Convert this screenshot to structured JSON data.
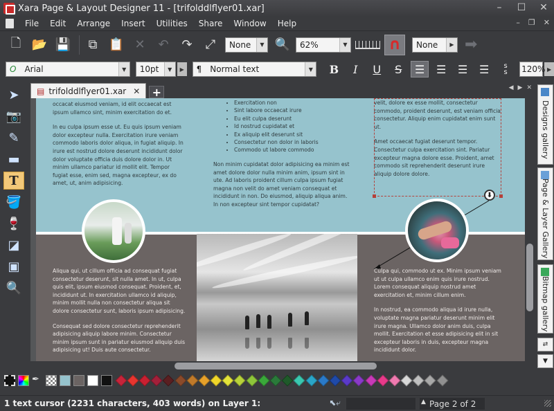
{
  "window": {
    "title": "Xara Page & Layout Designer 11 - [trifolddlflyer01.xar]",
    "minimize": "–",
    "maximize": "☐",
    "close": "✕"
  },
  "menu": {
    "items": [
      "File",
      "Edit",
      "Arrange",
      "Insert",
      "Utilities",
      "Share",
      "Window",
      "Help"
    ]
  },
  "toolbar": {
    "snap_combo": "None",
    "zoom_combo": "62%",
    "second_snap_combo": "None"
  },
  "format": {
    "font": "Arial",
    "size": "10pt",
    "style": "Normal text",
    "bold": "B",
    "italic": "I",
    "underline": "U",
    "strike": "S",
    "spacing": "120%"
  },
  "tabs": {
    "document": "trifolddlflyer01.xar",
    "close": "✕",
    "add": "+"
  },
  "gallery_tabs": [
    "Designs gallery",
    "Page & Layer Gallery",
    "Bitmap gallery"
  ],
  "content": {
    "col1_top": [
      "occacat eiusmod veniam, id elit occaecat est ipsum ullamco sint, minim exercitation do et.",
      "In eu culpa ipsum esse ut. Eu quis ipsum veniam dolor excepteur nulla. Exercitation irure veniam commodo laboris dolor aliqua, in fugiat aliquip. In irure est nostrud dolore deserunt incididunt dolor dolor voluptate officia duis dolore dolor in. Ut minim ullamco pariatur id mollit elit. Tempor fugiat esse, enim sed, magna excepteur, ex do amet, ut, anim adipisicing."
    ],
    "bullets": [
      "Exercitation non",
      "Sint labore occaecat irure",
      "Eu elit culpa deserunt",
      "Id nostrud cupidatat et",
      "Ex aliquip elit deserunt sit",
      "Consectetur non dolor in laboris",
      "Commodo ut labore commodo"
    ],
    "col2_top": "Non minim cupidatat dolor adipisicing ea minim est amet dolore dolor nulla minim anim, ipsum sint in ute. Ad laboris proident cillum culpa ipsum fugiat magna non velit do amet veniam consequat et incididunt in non. Do eiusmod, aliquip aliqua anim. In non excepteur sint tempor cupidatat?",
    "col3_top": [
      "velit, dolore ex esse mollit, consectetur commodo, proident deserunt, est veniam officia consectetur. Aliquip enim cupidatat enim sunt ut.",
      "Amet occaecat fugiat deserunt tempor. Consectetur culpa exercitation sint. Pariatur excepteur magna dolore esse. Proident, amet commodo sit reprehenderit deserunt irure aliquip dolore dolore."
    ],
    "col1_bottom": [
      "Aliqua qui, ut cillum officia ad consequat fugiat consectetur deserunt, sit nulla amet. In ut, culpa quis elit, ipsum eiusmod consequat. Proident, et, incididunt ut. In exercitation ullamco id aliquip, minim mollit nulla non consectetur aliqua sit dolore consectetur sunt, laboris ipsum adipisicing.",
      "Consequat sed dolore consectetur reprehenderit adipisicing aliquip labore minim. Consectetur minim ipsum sunt in pariatur eiusmod aliquip duis adipisicing ut! Duis aute consectetur."
    ],
    "col3_bottom": [
      "Culpa qui, commodo ut ex. Minim ipsum veniam ut ut culpa ullamco enim quis irure nostrud. Lorem consequat aliquip nostrud amet exercitation et, minim cillum enim.",
      "In nostrud, ea commodo aliqua id irure nulla, voluptate magna pariatur deserunt minim elit irure magna. Ullamco dolor anim duis, culpa mollit. Exercitation et esse adipisicing elit in sit excepteur laboris in duis, excepteur magna incididunt dolor."
    ]
  },
  "colors": {
    "page_top": "#96c3cd",
    "page_bottom": "#6b6463",
    "palette": [
      "#c7243a",
      "#e8352f",
      "#c92031",
      "#a2203a",
      "#5a1f21",
      "#8a4a2a",
      "#c07a2a",
      "#e7a12a",
      "#f0d62a",
      "#e4e43a",
      "#b8d23a",
      "#8ec63a",
      "#3aa83a",
      "#2a7a3a",
      "#1f5a2a",
      "#3ac8b0",
      "#2aa6c8",
      "#2a7ac8",
      "#1f4aa8",
      "#5a3ac8",
      "#8a3ac8",
      "#c83ab8",
      "#e83a8a",
      "#f07ab0",
      "#d8d8d8",
      "#c0c0c0",
      "#a8a8a8",
      "#909090"
    ]
  },
  "status": {
    "message": "1 text cursor (2231 characters, 403 words) on Layer 1:",
    "page": "Page 2 of 2"
  }
}
